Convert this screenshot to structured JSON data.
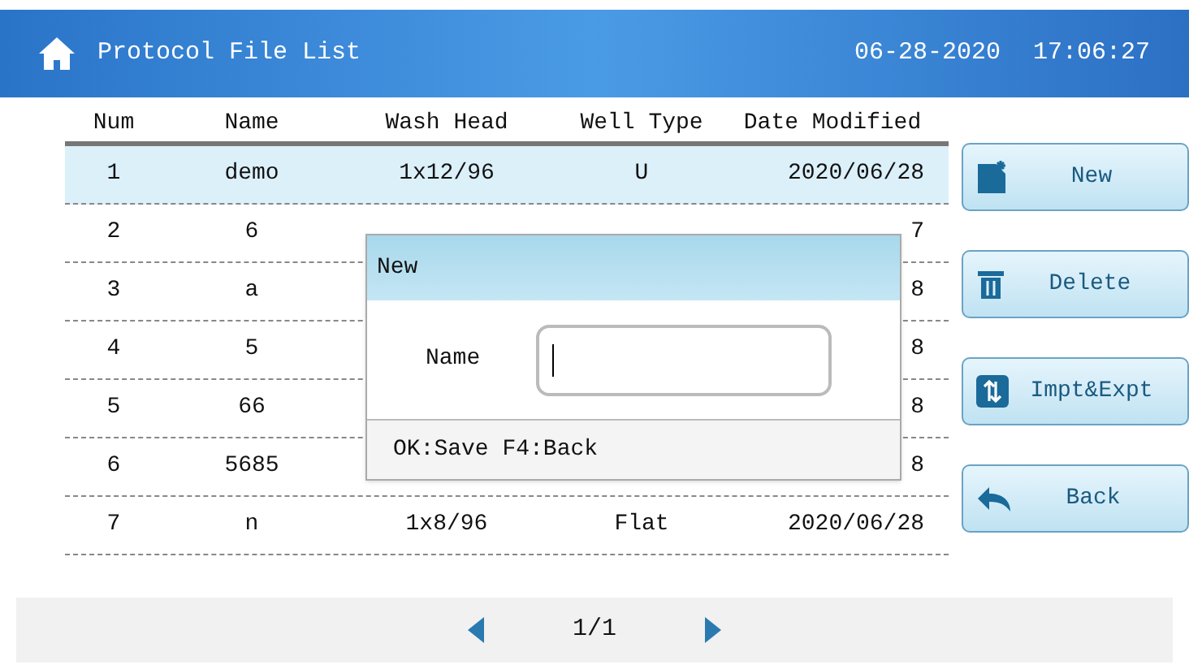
{
  "header": {
    "title": "Protocol File List",
    "date": "06-28-2020",
    "time": "17:06:27"
  },
  "table": {
    "columns": [
      "Num",
      "Name",
      "Wash Head",
      "Well Type",
      "Date Modified"
    ],
    "rows": [
      {
        "selected": true,
        "cells": [
          "1",
          "demo",
          "1x12/96",
          "U",
          "2020/06/28"
        ]
      },
      {
        "selected": false,
        "cells": [
          "2",
          "6",
          null,
          null,
          "7"
        ]
      },
      {
        "selected": false,
        "cells": [
          "3",
          "a",
          null,
          null,
          "8"
        ]
      },
      {
        "selected": false,
        "cells": [
          "4",
          "5",
          null,
          null,
          "8"
        ]
      },
      {
        "selected": false,
        "cells": [
          "5",
          "66",
          null,
          null,
          "8"
        ]
      },
      {
        "selected": false,
        "cells": [
          "6",
          "5685",
          null,
          null,
          "8"
        ]
      },
      {
        "selected": false,
        "cells": [
          "7",
          "n",
          "1x8/96",
          "Flat",
          "2020/06/28"
        ]
      }
    ]
  },
  "buttons": [
    {
      "kind": "new",
      "label": "New"
    },
    {
      "kind": "delete",
      "label": "Delete"
    },
    {
      "kind": "transfer",
      "label": "Impt&Expt"
    },
    {
      "kind": "back",
      "label": "Back"
    }
  ],
  "dialog": {
    "title": "New",
    "field_label": "Name",
    "hint": "OK:Save F4:Back"
  },
  "pager": {
    "page": "1/1"
  }
}
